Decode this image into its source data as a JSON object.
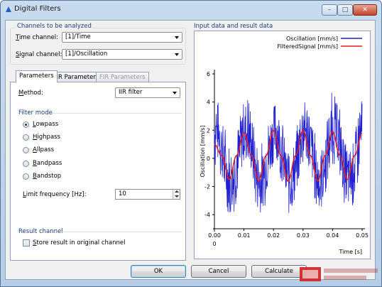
{
  "window": {
    "title": "Digital Filters"
  },
  "channels": {
    "group_label": "Channels to be analyzed",
    "time_label_key": "T",
    "time_label_rest": "ime channel:",
    "time_value": "[1]/Time",
    "signal_label_key": "S",
    "signal_label_rest": "ignal channel:",
    "signal_value": "[1]/Oscillation"
  },
  "tabs": [
    {
      "label": "Parameters",
      "state": "active"
    },
    {
      "label": "IIR Parameters",
      "state": "normal"
    },
    {
      "label": "FIR Parameters",
      "state": "disabled"
    }
  ],
  "parameters": {
    "method_key": "M",
    "method_rest": "ethod:",
    "method_value": "IIR filter",
    "filter_mode_label": "Filter mode",
    "modes": [
      {
        "key": "L",
        "rest": "owpass",
        "checked": true
      },
      {
        "key": "H",
        "rest": "ighpass",
        "checked": false
      },
      {
        "key": "A",
        "rest": "llpass",
        "checked": false
      },
      {
        "key": "B",
        "rest": "andpass",
        "checked": false
      },
      {
        "key": "B",
        "rest": "andstop",
        "checked": false
      }
    ],
    "limit_key": "L",
    "limit_rest": "imit frequency [Hz]:",
    "limit_value": "10",
    "result_channel_label": "Result channel",
    "store_key": "S",
    "store_rest": "tore result in original channel",
    "store_checked": false
  },
  "chart_panel_label": "Input data and result data",
  "chart_data": {
    "type": "line",
    "xlabel": "Time [s]",
    "ylabel": "Oscillation [mm/s]",
    "xlim": [
      0,
      0.05
    ],
    "ylim": [
      -5,
      6
    ],
    "xticks": [
      "0.00",
      "0.01",
      "0.02",
      "0.03",
      "0.04",
      "0.05"
    ],
    "x_origin_label": "0",
    "yticks": [
      "-4",
      "-2",
      "0",
      "2",
      "4",
      "6"
    ],
    "legend_position": "top-right",
    "series": [
      {
        "name": "Oscillation [mm/s]",
        "color": "#2020d0",
        "description_points": {
          "x": [
            0.0,
            0.005,
            0.01,
            0.015,
            0.02,
            0.025,
            0.03,
            0.035,
            0.04,
            0.045,
            0.05
          ],
          "y": [
            2.0,
            -1.5,
            2.0,
            -1.5,
            2.0,
            -1.5,
            2.0,
            -1.5,
            2.0,
            -1.5,
            2.0
          ]
        }
      },
      {
        "name": "FilteredSignal [mm/s]",
        "color": "#e02020",
        "x": [
          0.0,
          0.0025,
          0.005,
          0.0075,
          0.01,
          0.0125,
          0.015,
          0.0175,
          0.02,
          0.0225,
          0.025,
          0.0275,
          0.03,
          0.0325,
          0.035,
          0.0375,
          0.04,
          0.0425,
          0.045,
          0.0475,
          0.05
        ],
        "y": [
          1.0,
          0.2,
          -1.5,
          0.2,
          1.8,
          0.2,
          -1.6,
          0.2,
          2.0,
          0.2,
          -1.6,
          0.2,
          2.0,
          0.2,
          -1.6,
          0.2,
          1.9,
          0.2,
          -1.5,
          0.2,
          1.8
        ]
      }
    ]
  },
  "buttons": {
    "ok": "OK",
    "cancel": "Cancel",
    "calculate": "Calculate"
  }
}
